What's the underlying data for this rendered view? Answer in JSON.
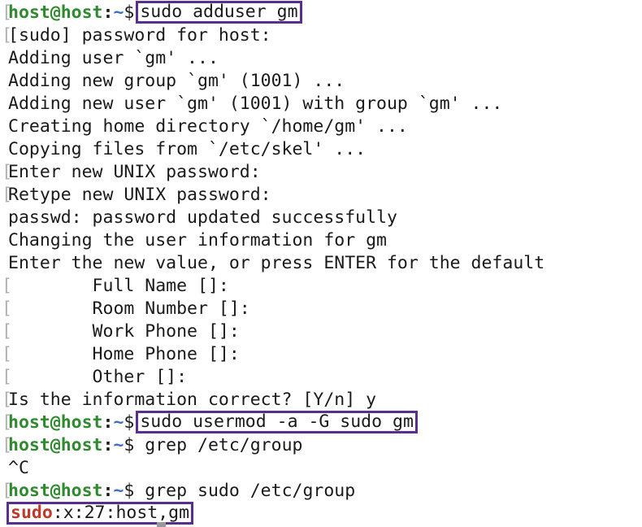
{
  "prompt": {
    "user_host": "host@host",
    "sep": ":",
    "path": "~",
    "dollar": "$ "
  },
  "lines": {
    "l1_cmd": "sudo adduser gm",
    "l2": "[sudo] password for host:",
    "l3": "Adding user `gm' ...",
    "l4": "Adding new group `gm' (1001) ...",
    "l5": "Adding new user `gm' (1001) with group `gm' ...",
    "l6": "Creating home directory `/home/gm' ...",
    "l7": "Copying files from `/etc/skel' ...",
    "l8": "Enter new UNIX password:",
    "l9": "Retype new UNIX password:",
    "l10": "passwd: password updated successfully",
    "l11": "Changing the user information for gm",
    "l12": "Enter the new value, or press ENTER for the default",
    "l13": "        Full Name []:",
    "l14": "        Room Number []:",
    "l15": "        Work Phone []:",
    "l16": "        Home Phone []:",
    "l17": "        Other []:",
    "l18": "Is the information correct? [Y/n] y",
    "l19_cmd": "sudo usermod -a -G sudo gm",
    "l20_cmd": "grep /etc/group",
    "l21": "^C",
    "l22_cmd": "grep sudo /etc/group",
    "l23_match": "sudo",
    "l23_rest": ":x:27:host,gm"
  },
  "colors": {
    "prompt_user": "#2f8a2f",
    "prompt_path": "#3b6fc4",
    "highlight_box": "#5a2d91",
    "grep_match": "#c0392b"
  }
}
